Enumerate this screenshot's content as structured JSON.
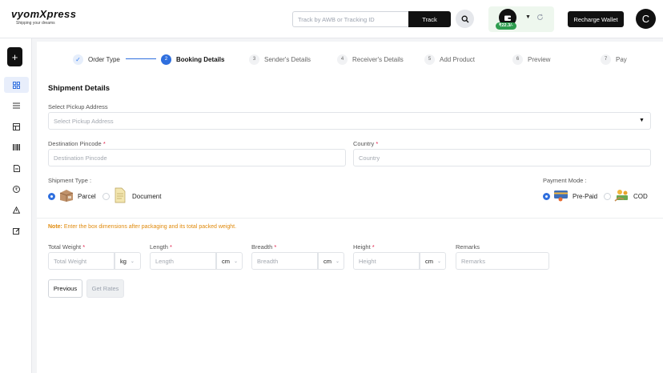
{
  "brand": {
    "name": "vyomXpress",
    "tagline": "Shipping your dreams"
  },
  "header": {
    "track_placeholder": "Track by AWB or Tracking ID",
    "track_label": "Track",
    "wallet_amount": "₹22.3/-",
    "recharge_label": "Recharge Wallet",
    "avatar_initial": "C"
  },
  "steps": [
    {
      "num": "1",
      "label": "Order Type",
      "state": "done"
    },
    {
      "num": "2",
      "label": "Booking Details",
      "state": "active"
    },
    {
      "num": "3",
      "label": "Sender's Details",
      "state": "pending"
    },
    {
      "num": "4",
      "label": "Receiver's Details",
      "state": "pending"
    },
    {
      "num": "5",
      "label": "Add Product",
      "state": "pending"
    },
    {
      "num": "6",
      "label": "Preview",
      "state": "pending"
    },
    {
      "num": "7",
      "label": "Pay",
      "state": "pending"
    }
  ],
  "form": {
    "section_title": "Shipment Details",
    "pickup_label": "Select Pickup Address",
    "pickup_placeholder": "Select Pickup Address",
    "pincode_label": "Destination Pincode",
    "pincode_placeholder": "Destination Pincode",
    "country_label": "Country",
    "country_placeholder": "Country",
    "shipment_type_label": "Shipment Type :",
    "shipment_types": [
      {
        "label": "Parcel",
        "selected": true
      },
      {
        "label": "Document",
        "selected": false
      }
    ],
    "payment_mode_label": "Payment Mode :",
    "payment_modes": [
      {
        "label": "Pre-Paid",
        "selected": true
      },
      {
        "label": "COD",
        "selected": false
      }
    ],
    "note_prefix": "Note:",
    "note_text": " Enter the box dimensions after packaging and its total packed weight.",
    "weight_label": "Total Weight",
    "weight_placeholder": "Total Weight",
    "weight_unit": "kg",
    "length_label": "Length",
    "length_placeholder": "Length",
    "length_unit": "cm",
    "breadth_label": "Breadth",
    "breadth_placeholder": "Breadth",
    "breadth_unit": "cm",
    "height_label": "Height",
    "height_placeholder": "Height",
    "height_unit": "cm",
    "remarks_label": "Remarks",
    "remarks_placeholder": "Remarks",
    "required_mark": "*"
  },
  "actions": {
    "previous_label": "Previous",
    "get_rates_label": "Get Rates"
  },
  "colors": {
    "accent": "#2f6fde",
    "note": "#e08a0c",
    "wallet_green": "#2e9d4f"
  },
  "icons": {
    "sidebar": [
      "plus-icon",
      "dashboard-icon",
      "list-icon",
      "orders-icon",
      "barcode-icon",
      "document-icon",
      "rupee-icon",
      "warning-icon",
      "edit-icon"
    ]
  }
}
